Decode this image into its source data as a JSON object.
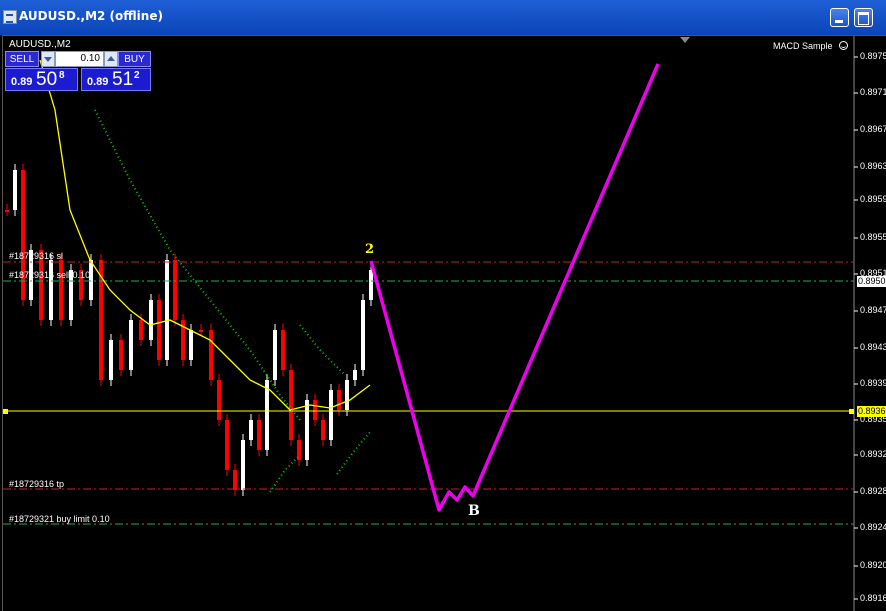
{
  "window": {
    "title": "AUDUSD.,M2 (offline)"
  },
  "chart": {
    "symbol_label": "AUDUSD.,M2",
    "indicator_label": "MACD Sample",
    "price_ticks": [
      "0.8975",
      "0.8971",
      "0.8967",
      "0.8963",
      "0.8959",
      "0.8955",
      "0.8951",
      "0.8947",
      "0.8943",
      "0.8939",
      "0.8935",
      "0.8932",
      "0.8928",
      "0.8924",
      "0.8920",
      "0.8916"
    ],
    "current_price_badge": "0.8950",
    "hline_price_badge": "0.8936",
    "annotation_2": "2",
    "annotation_b": "B"
  },
  "trade_panel": {
    "sell_label": "SELL",
    "buy_label": "BUY",
    "lot_value": "0.10",
    "sell_price_prefix": "0.89",
    "sell_price_big": "50",
    "sell_price_sup": "8",
    "buy_price_prefix": "0.89",
    "buy_price_big": "51",
    "buy_price_sup": "2"
  },
  "orders": {
    "sl_label": "#18729316 sl",
    "sell_label": "#18729316 sell 0.10",
    "tp_label": "#18729316 tp",
    "buy_limit_label": "#18729321 buy limit 0.10"
  },
  "colors": {
    "background": "#000000",
    "candle_up": "#ffffff",
    "candle_down": "#ff0000",
    "ma_line": "#ffff00",
    "dotted_line": "#00cc00",
    "drawn_path": "#ee00ee",
    "order_line_red": "#cc2222",
    "order_line_green": "#22aa55",
    "hline": "#ffff00",
    "title_bar": "#0b44b8"
  }
}
